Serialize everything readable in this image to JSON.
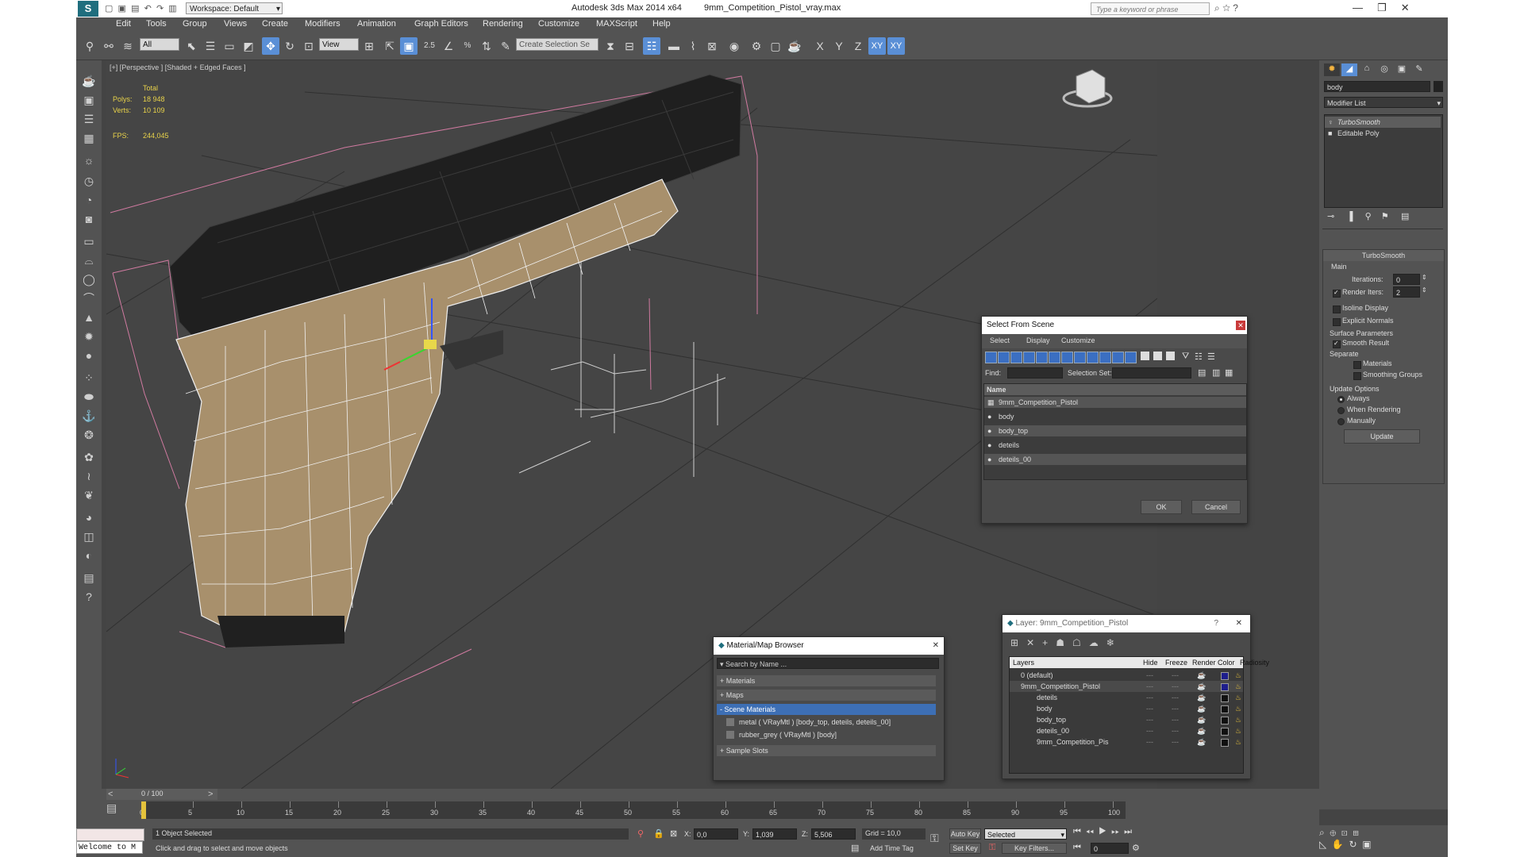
{
  "title_bar": {
    "workspace_label": "Workspace: Default",
    "app_title": "Autodesk 3ds Max  2014 x64",
    "file_name": "9mm_Competition_Pistol_vray.max",
    "search_placeholder": "Type a keyword or phrase"
  },
  "menu": [
    "Edit",
    "Tools",
    "Group",
    "Views",
    "Create",
    "Modifiers",
    "Animation",
    "Graph Editors",
    "Rendering",
    "Customize",
    "MAXScript",
    "Help"
  ],
  "toolbar": {
    "filter_value": "All",
    "ref_coord_value": "View",
    "snap_label": "2.5",
    "percent_snap_label": "%",
    "named_selection_placeholder": "Create Selection Se",
    "axis_x": "X",
    "axis_y": "Y",
    "axis_z": "Z",
    "axis_xy": "XY",
    "axis_xy2": "XY"
  },
  "viewport": {
    "label": "[+] [Perspective ] [Shaded + Edged Faces ]",
    "stats_total": "Total",
    "polys_label": "Polys:",
    "polys_value": "18 948",
    "verts_label": "Verts:",
    "verts_value": "10 109",
    "fps_label": "FPS:",
    "fps_value": "244,045"
  },
  "command_panel": {
    "object_name": "body",
    "modifier_list_label": "Modifier List",
    "stack": [
      "TurboSmooth",
      "Editable Poly"
    ],
    "rollout_title": "TurboSmooth",
    "main_label": "Main",
    "iterations_label": "Iterations:",
    "iterations_value": "0",
    "render_iters_label": "Render Iters:",
    "render_iters_value": "2",
    "isoline_label": "Isoline Display",
    "explicit_normals_label": "Explicit Normals",
    "surface_params_label": "Surface Parameters",
    "smooth_result_label": "Smooth Result",
    "separate_label": "Separate",
    "materials_label": "Materials",
    "smoothing_groups_label": "Smoothing Groups",
    "update_options_label": "Update Options",
    "always_label": "Always",
    "when_rendering_label": "When Rendering",
    "manually_label": "Manually",
    "update_button": "Update"
  },
  "select_from_scene": {
    "title": "Select From Scene",
    "menu": [
      "Select",
      "Display",
      "Customize"
    ],
    "find_label": "Find:",
    "selection_set_label": "Selection Set:",
    "name_header": "Name",
    "items": [
      "9mm_Competition_Pistol",
      "body",
      "body_top",
      "deteils",
      "deteils_00"
    ],
    "ok": "OK",
    "cancel": "Cancel"
  },
  "material_browser": {
    "title": "Material/Map Browser",
    "search_placeholder": "Search by Name ...",
    "sections": [
      "+ Materials",
      "+ Maps",
      "- Scene Materials"
    ],
    "scene_materials": [
      "metal  ( VRayMtl ) [body_top, deteils, deteils_00]",
      "rubber_grey  ( VRayMtl ) [body]"
    ],
    "sample_slots": "+ Sample Slots"
  },
  "layer_manager": {
    "title": "Layer: 9mm_Competition_Pistol",
    "help": "?",
    "columns": [
      "Layers",
      "Hide",
      "Freeze",
      "Render",
      "Color",
      "Radiosity"
    ],
    "rows": [
      {
        "name": "0 (default)",
        "color": "#1e1e8c"
      },
      {
        "name": "9mm_Competition_Pistol",
        "color": "#1e1e8c"
      },
      {
        "name": "deteils",
        "color": "#111111"
      },
      {
        "name": "body",
        "color": "#111111"
      },
      {
        "name": "body_top",
        "color": "#111111"
      },
      {
        "name": "deteils_00",
        "color": "#111111"
      },
      {
        "name": "9mm_Competition_Pis",
        "color": "#111111"
      }
    ]
  },
  "timeline": {
    "frame_counter": "0 / 100",
    "ticks": [
      "0",
      "5",
      "10",
      "15",
      "20",
      "25",
      "30",
      "35",
      "40",
      "45",
      "50",
      "55",
      "60",
      "65",
      "70",
      "75",
      "80",
      "85",
      "90",
      "95",
      "100"
    ]
  },
  "status": {
    "listener_text": "Welcome to M",
    "selection_status": "1 Object Selected",
    "prompt": "Click and drag to select and move objects",
    "x_label": "X:",
    "x_value": "0,0",
    "y_label": "Y:",
    "y_value": "1,039",
    "z_label": "Z:",
    "z_value": "5,506",
    "grid": "Grid = 10,0",
    "auto_key": "Auto Key",
    "set_key": "Set Key",
    "selected_dropdown": "Selected",
    "key_filters": "Key Filters...",
    "add_time_tag": "Add Time Tag",
    "frame_value": "0"
  }
}
